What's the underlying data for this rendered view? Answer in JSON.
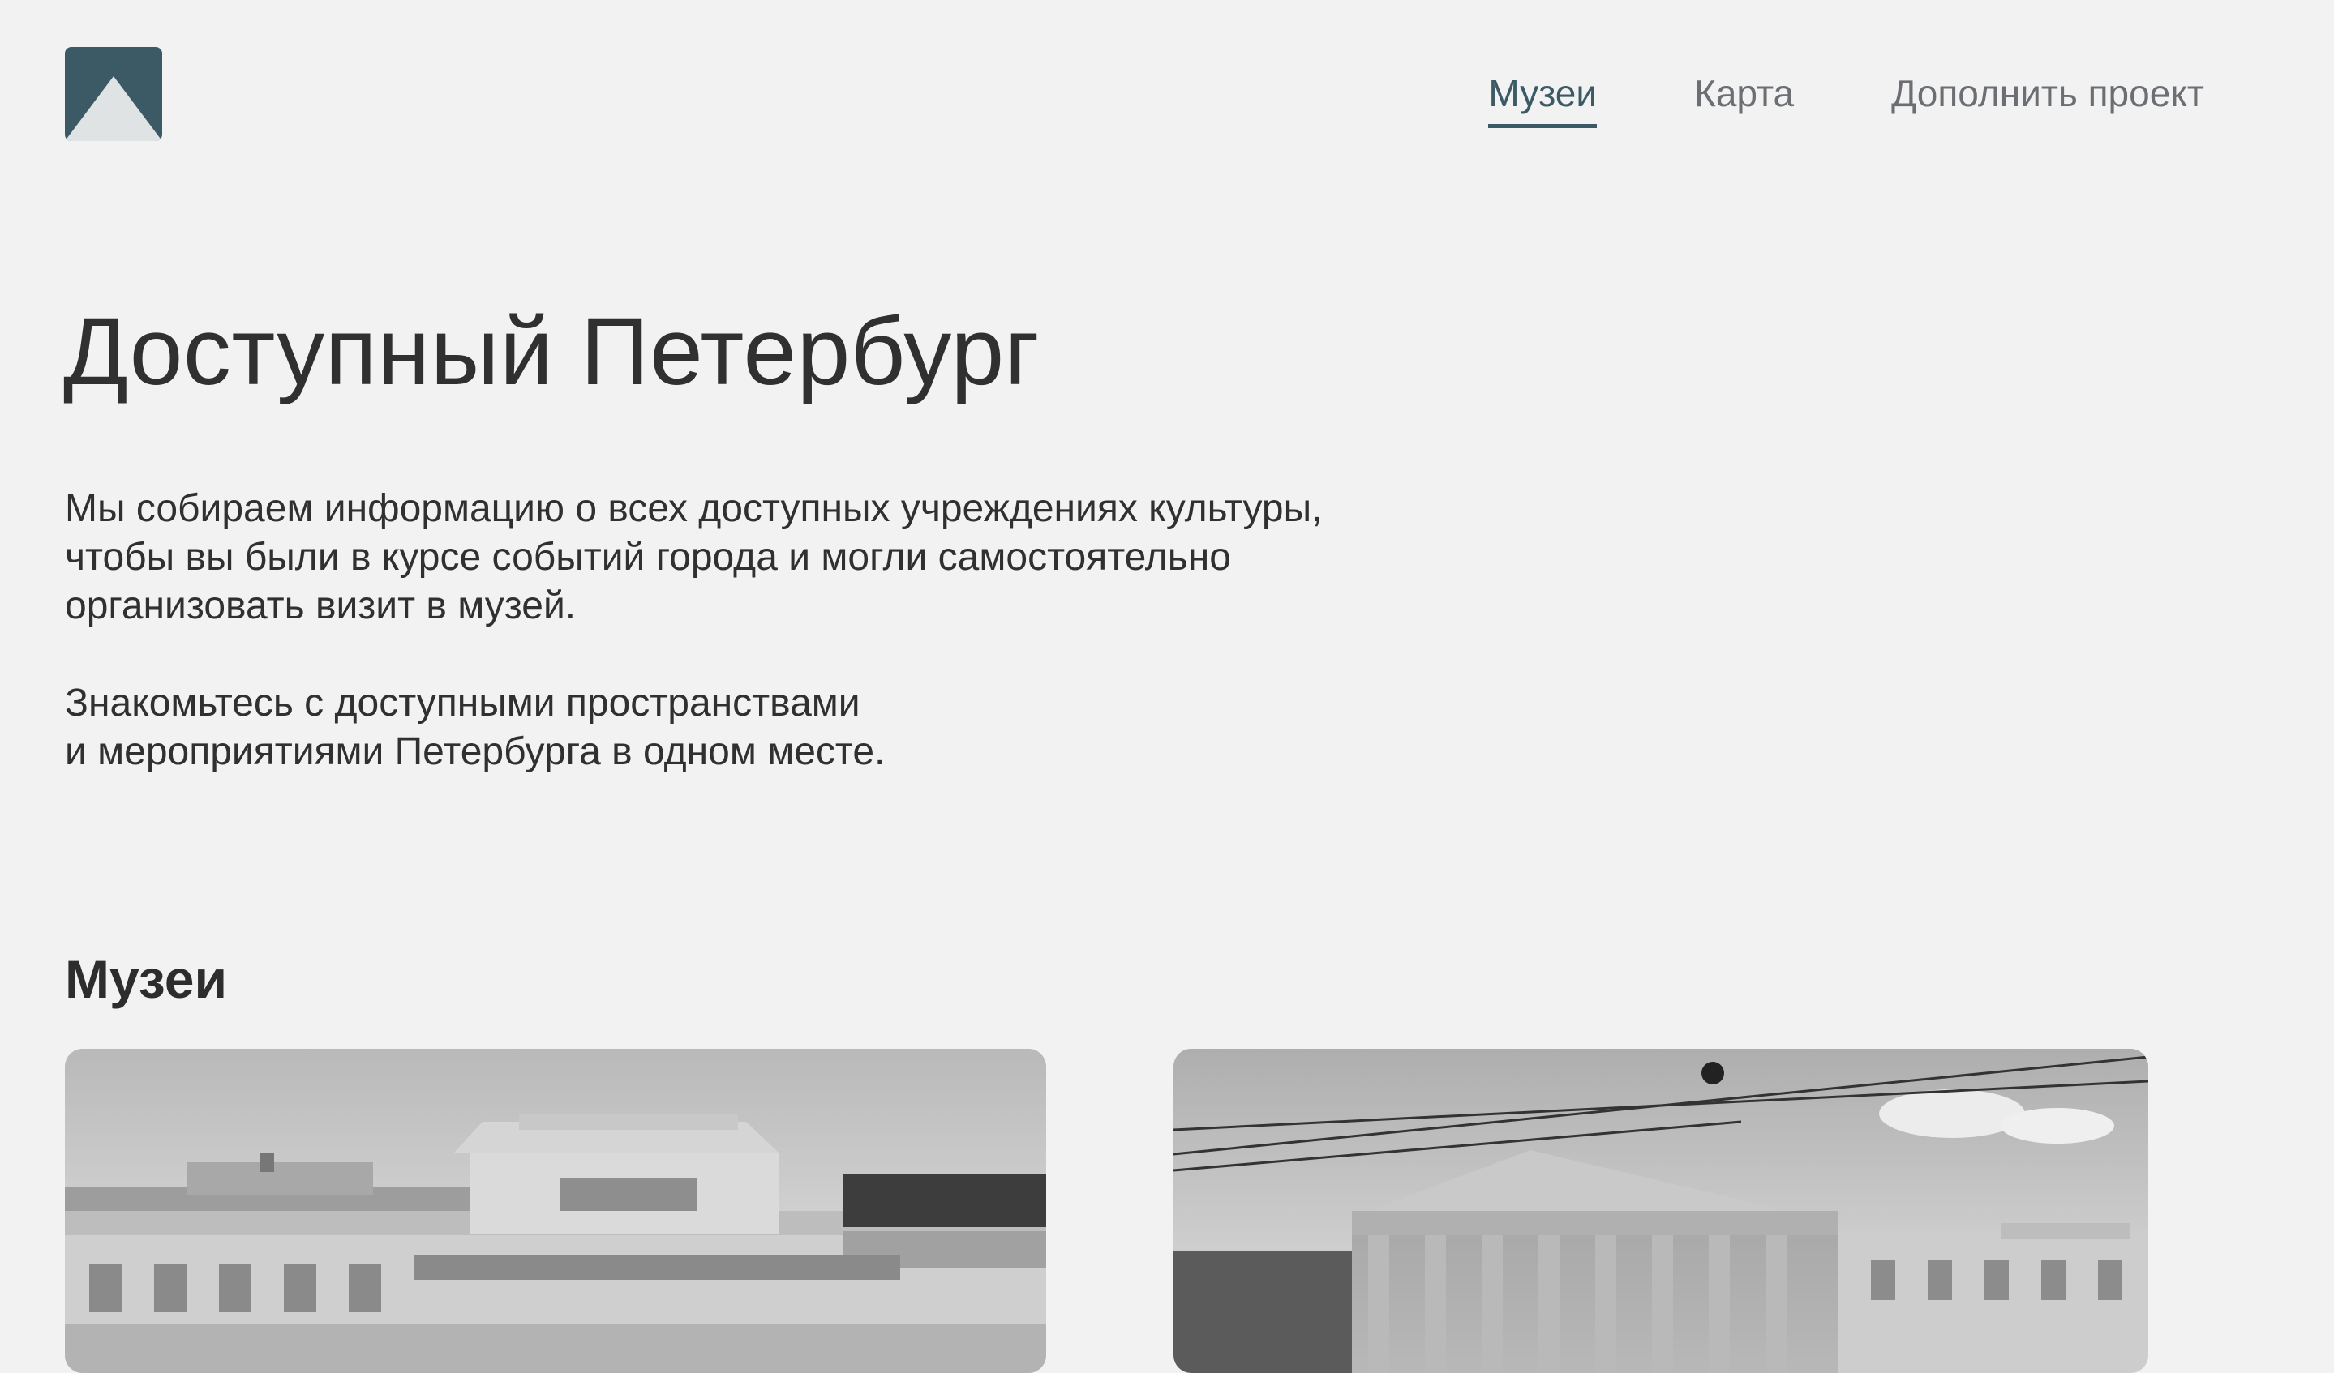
{
  "header": {
    "logo_icon": "mountain-logo-icon",
    "nav": [
      {
        "label": "Музеи",
        "active": true
      },
      {
        "label": "Карта",
        "active": false
      },
      {
        "label": "Дополнить проект",
        "active": false
      }
    ]
  },
  "hero": {
    "title": "Доступный Петербург",
    "paragraphs": [
      "Мы собираем информацию о всех доступных учреждениях культуры,\nчтобы вы были в курсе событий города и могли самостоятельно\nорганизовать визит в музей.",
      "Знакомьтесь с доступными пространствами\nи мероприятиями Петербурга в одном месте."
    ]
  },
  "museums": {
    "heading": "Музеи",
    "cards": [
      {
        "image": "museum-photo-ethnographic-museum"
      },
      {
        "image": "museum-photo-manege"
      }
    ]
  },
  "colors": {
    "background": "#f2f2f2",
    "accent": "#3b5a66",
    "nav_text": "#6b6f73",
    "body_text": "#303030"
  }
}
